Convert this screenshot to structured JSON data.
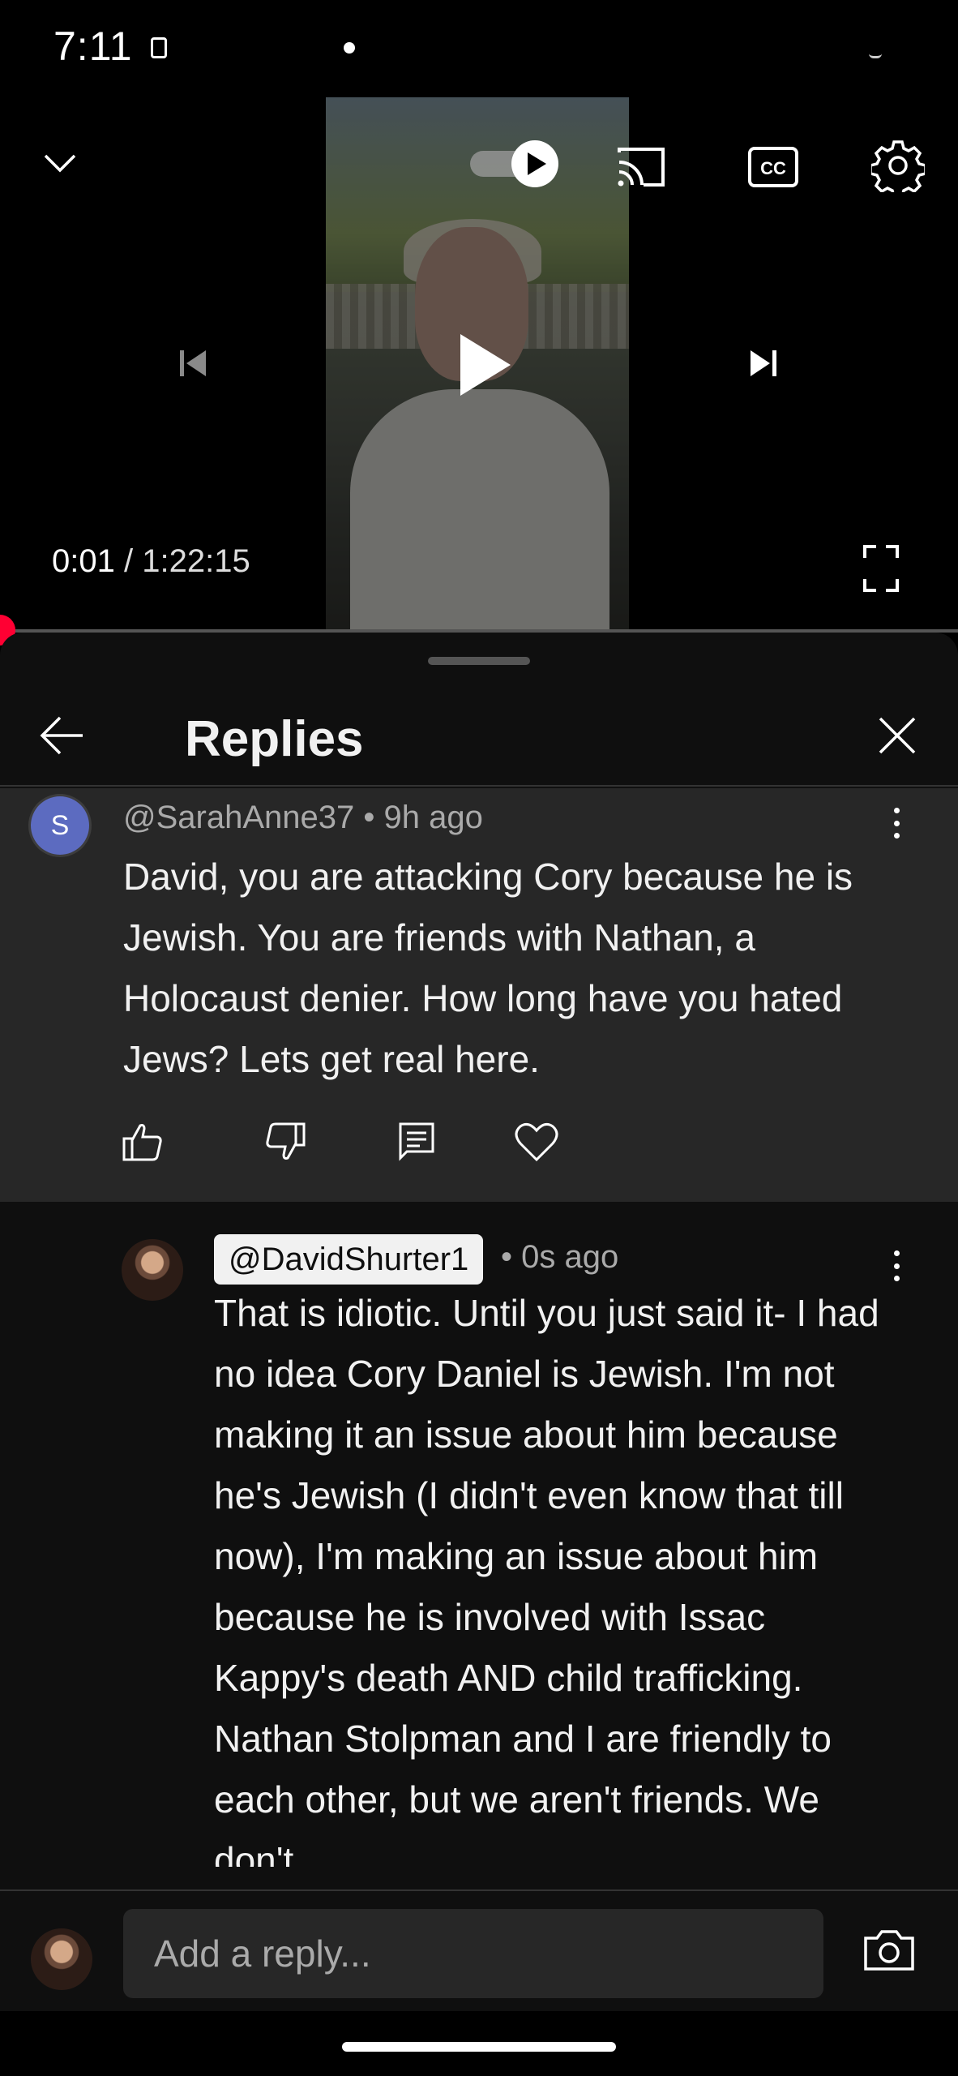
{
  "status_bar": {
    "time": "7:11"
  },
  "player": {
    "current_time": "0:01",
    "separator": "/",
    "duration": "1:22:15",
    "progress_fraction": 1.24e-05,
    "icons": {
      "collapse": "chevron-down-icon",
      "autoplay": "autoplay-toggle",
      "cast": "cast-icon",
      "captions": "cc-icon",
      "settings": "gear-icon",
      "previous": "skip-previous-icon",
      "play": "play-icon",
      "next": "skip-next-icon",
      "fullscreen": "fullscreen-icon"
    },
    "accent_color": "#ff0000"
  },
  "panel": {
    "title": "Replies"
  },
  "parent_comment": {
    "avatar_letter": "S",
    "avatar_color": "#5c6bc0",
    "author_line": "@SarahAnne37 • 9h ago",
    "text": "David, you are attacking Cory because he is Jewish. You are friends with Nathan, a Holocaust denier. How long have you hated Jews? Lets get real here.",
    "actions": [
      "like-icon",
      "dislike-icon",
      "reply-icon",
      "heart-icon"
    ]
  },
  "reply_comment": {
    "author": "@DavidShurter1",
    "meta": "• 0s ago",
    "text": "That is idiotic. Until you just said it- I had no idea Cory Daniel is Jewish. I'm not making it an issue about him because he's Jewish (I didn't even know that till now), I'm making an issue about him because he is involved with Issac Kappy's death AND child trafficking. Nathan Stolpman and I are friendly to each other, but we aren't friends. We don't"
  },
  "composer": {
    "placeholder": "Add a reply..."
  }
}
